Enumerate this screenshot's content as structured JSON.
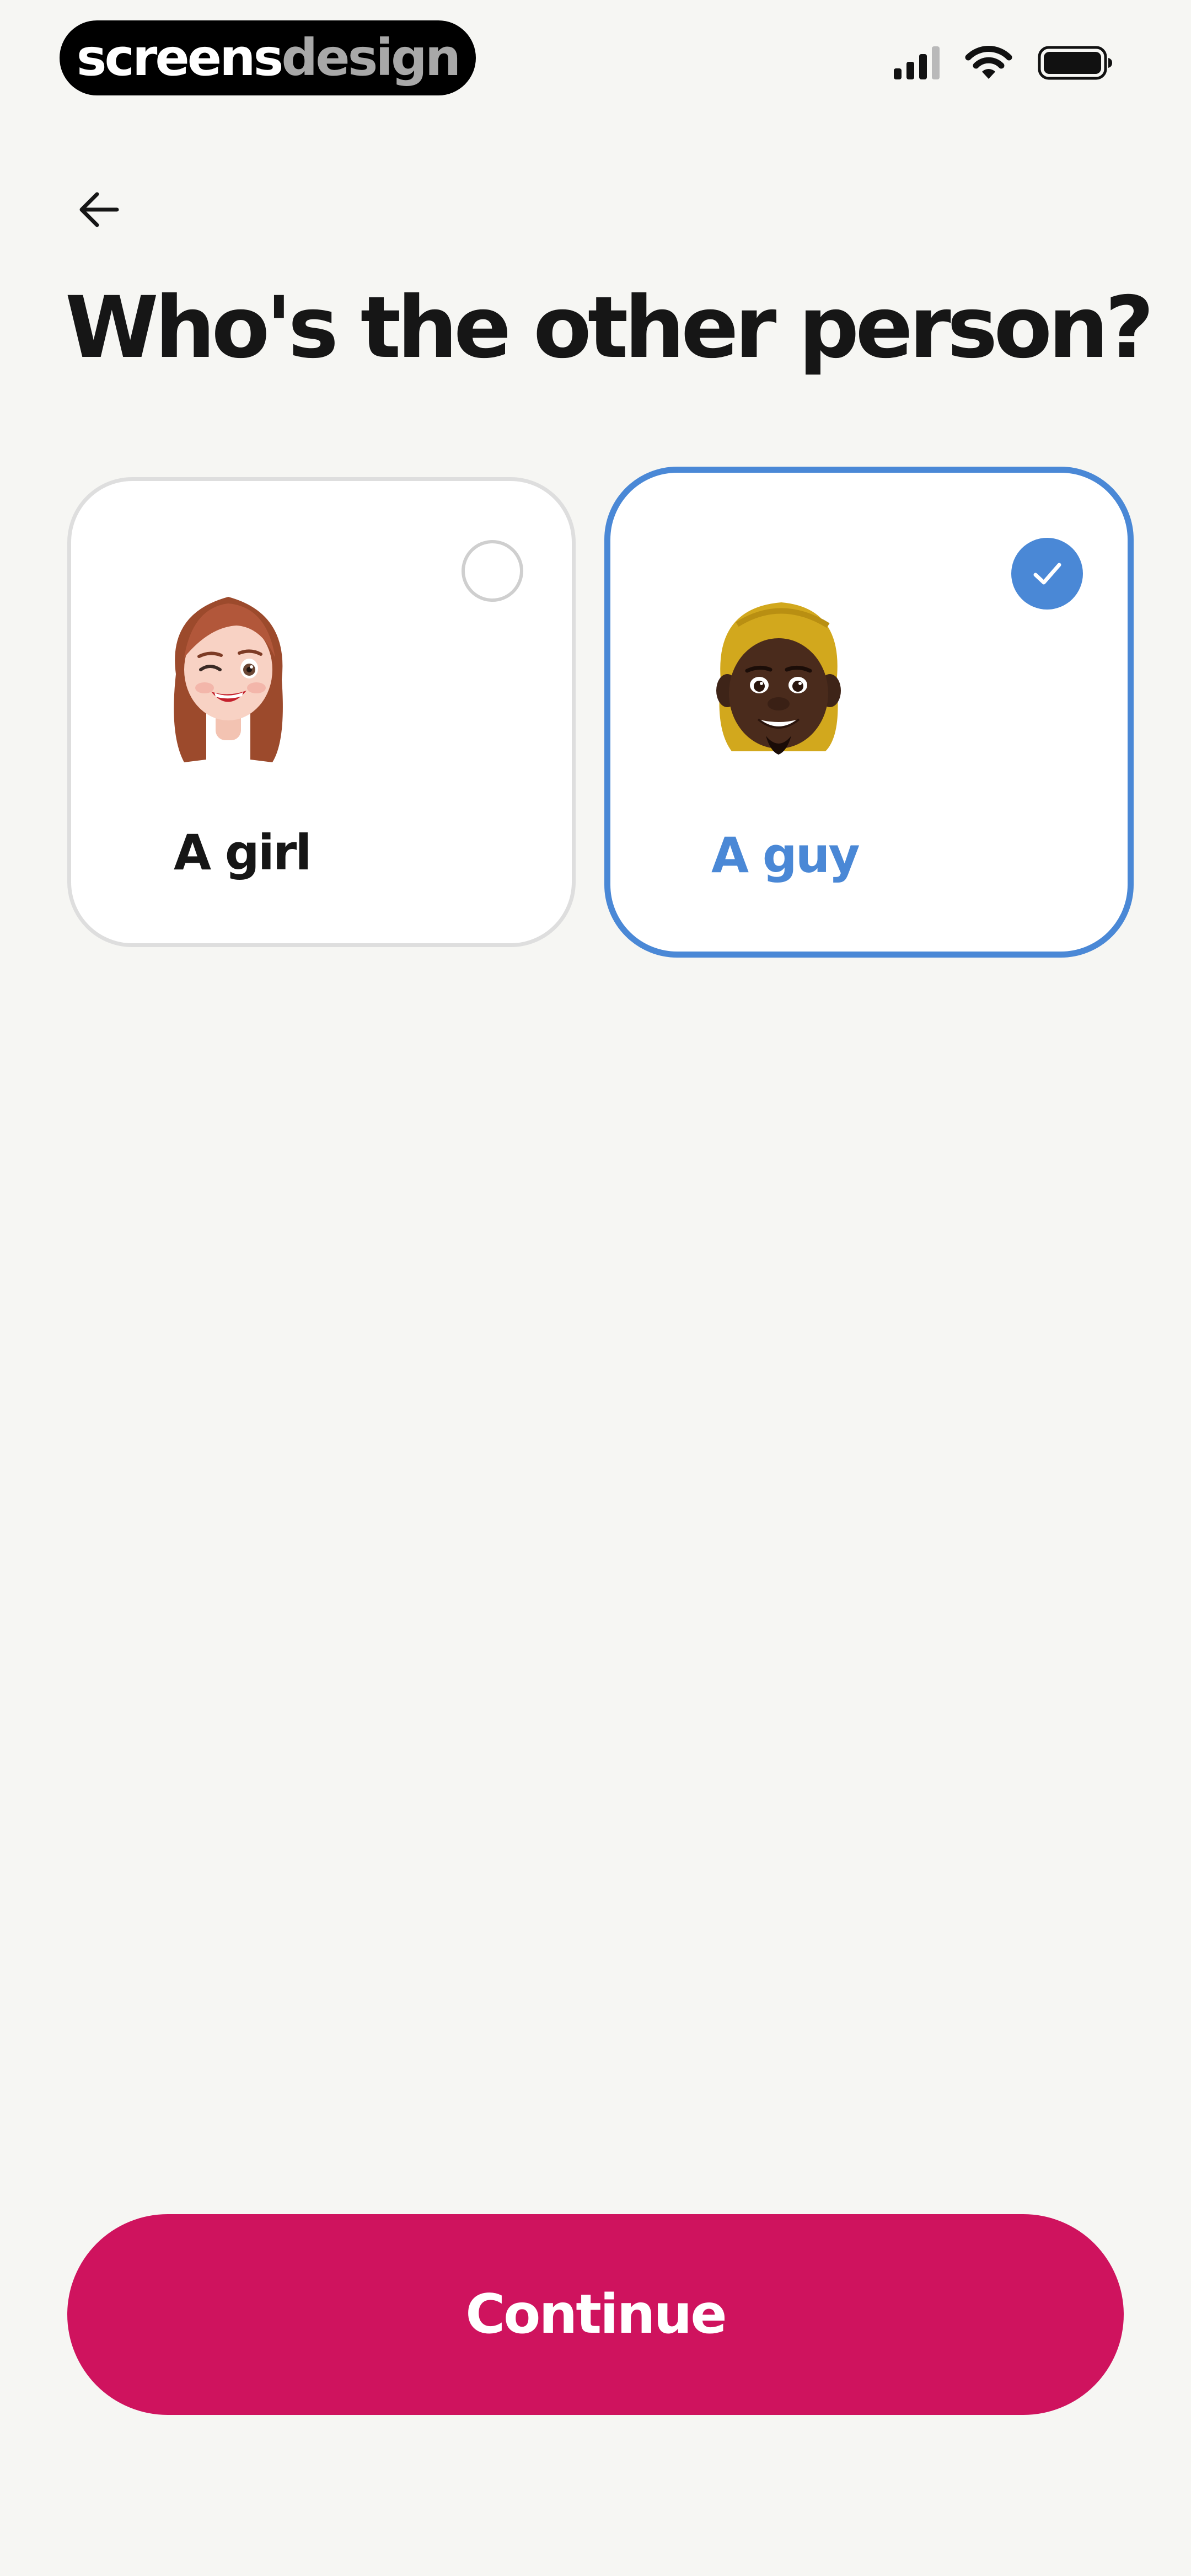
{
  "status_bar": {
    "brand_primary": "screens",
    "brand_secondary": "design",
    "icons": [
      "cellular-signal-icon",
      "wifi-icon",
      "battery-icon"
    ]
  },
  "nav": {
    "back_icon": "arrow-left-icon"
  },
  "title": "Who's the other person?",
  "options": [
    {
      "label": "A girl",
      "avatar": "girl-memoji-winking",
      "selected": false
    },
    {
      "label": "A guy",
      "avatar": "guy-memoji-smiling",
      "selected": true
    }
  ],
  "continue_label": "Continue",
  "colors": {
    "background": "#f6f6f3",
    "accent_blue": "#4a88d6",
    "continue_button": "#cf135e",
    "title_text": "#161616",
    "card_border_unselected": "#dedede"
  }
}
